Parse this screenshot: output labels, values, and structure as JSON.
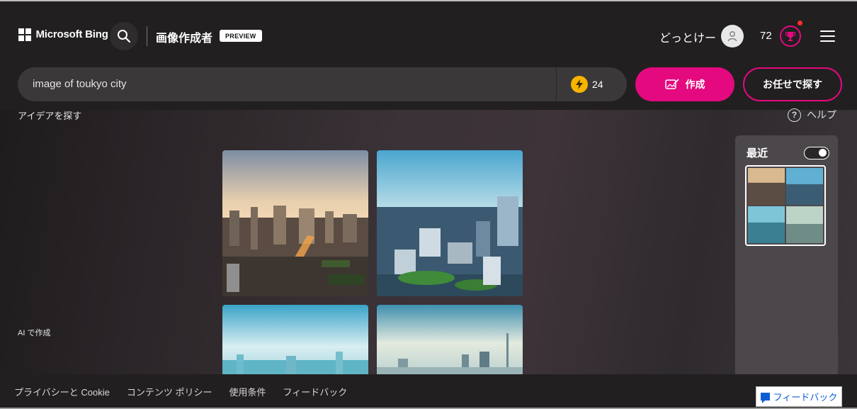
{
  "header": {
    "brand": "Microsoft Bing",
    "page_title": "画像作成者",
    "preview_badge": "PREVIEW",
    "username": "どっとけー",
    "points": "72"
  },
  "prompt": {
    "value": "image of toukyo city",
    "boost_count": "24",
    "create_label": "作成",
    "surprise_label": "お任せで探す"
  },
  "content": {
    "ideas_link": "アイデアを探す",
    "help_label": "ヘルプ",
    "help_glyph": "?",
    "ai_made_label": "AI で作成"
  },
  "recent": {
    "title": "最近"
  },
  "footer": {
    "links": [
      "プライバシーと Cookie",
      "コンテンツ ポリシー",
      "使用条件",
      "フィードバック"
    ],
    "feedback_button": "フィードバック"
  },
  "colors": {
    "accent": "#e5097f",
    "boost": "#f5b400",
    "background": "#221f20"
  },
  "icons": [
    "windows-logo-icon",
    "search-icon",
    "user-icon",
    "trophy-icon",
    "menu-icon",
    "bolt-icon",
    "image-create-icon",
    "help-icon",
    "feedback-icon"
  ]
}
